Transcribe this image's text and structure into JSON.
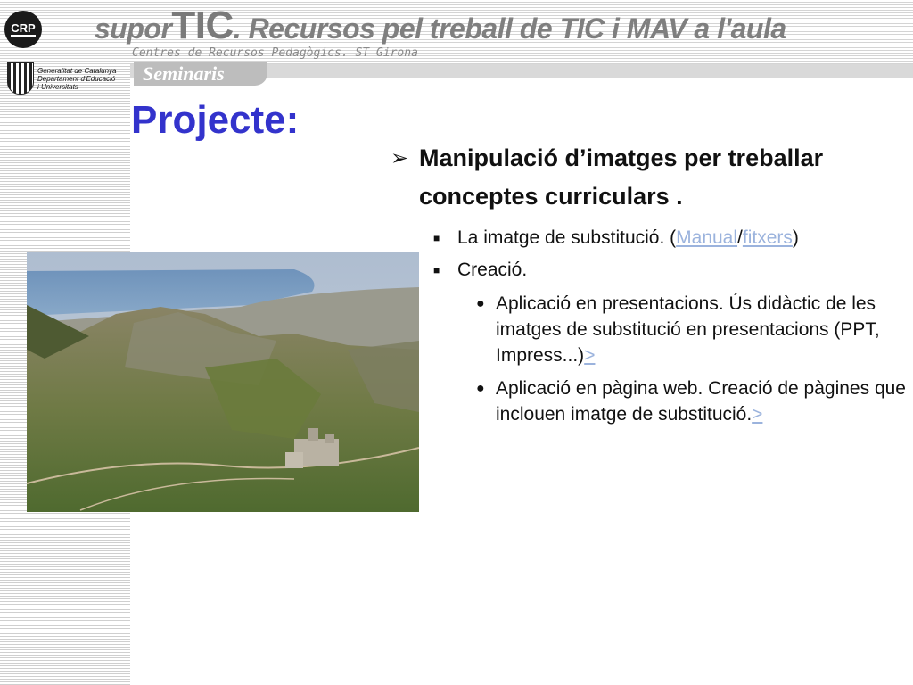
{
  "header": {
    "logo_text": "CRP",
    "title_prefix": "supor",
    "title_big": "TIC",
    "title_rest": ". Recursos pel treball de TIC i MAV a l'aula",
    "subtitle": "Centres de Recursos Pedagògics. ST Girona",
    "gencat_line1": "Generalitat de Catalunya",
    "gencat_line2": "Departament d'Educació",
    "gencat_line3": "i Universitats",
    "section_tab": "Seminaris"
  },
  "slide": {
    "title": "Projecte:",
    "main_point": "Manipulació d’imatges per treballar conceptes curriculars .",
    "sub1_text": "La imatge de substitució. (",
    "sub1_link1": "Manual",
    "sub1_sep": "/",
    "sub1_link2": "fitxers",
    "sub1_close": ")",
    "sub2_text": "Creació.",
    "item1_text": "Aplicació en presentacions. Ús didàctic de les imatges de substitució en presentacions (PPT, Impress...)",
    "item1_link": ">",
    "item2_text": "Aplicació en pàgina web. Creació de pàgines que inclouen imatge de substitució.",
    "item2_link": ">"
  },
  "colors": {
    "title": "#3333cc",
    "link": "#9bb3dd"
  },
  "icons": {
    "main_bullet": "arrow-bullet-icon",
    "sub_bullet": "square-bullet-icon",
    "item_bullet": "round-bullet-icon"
  }
}
